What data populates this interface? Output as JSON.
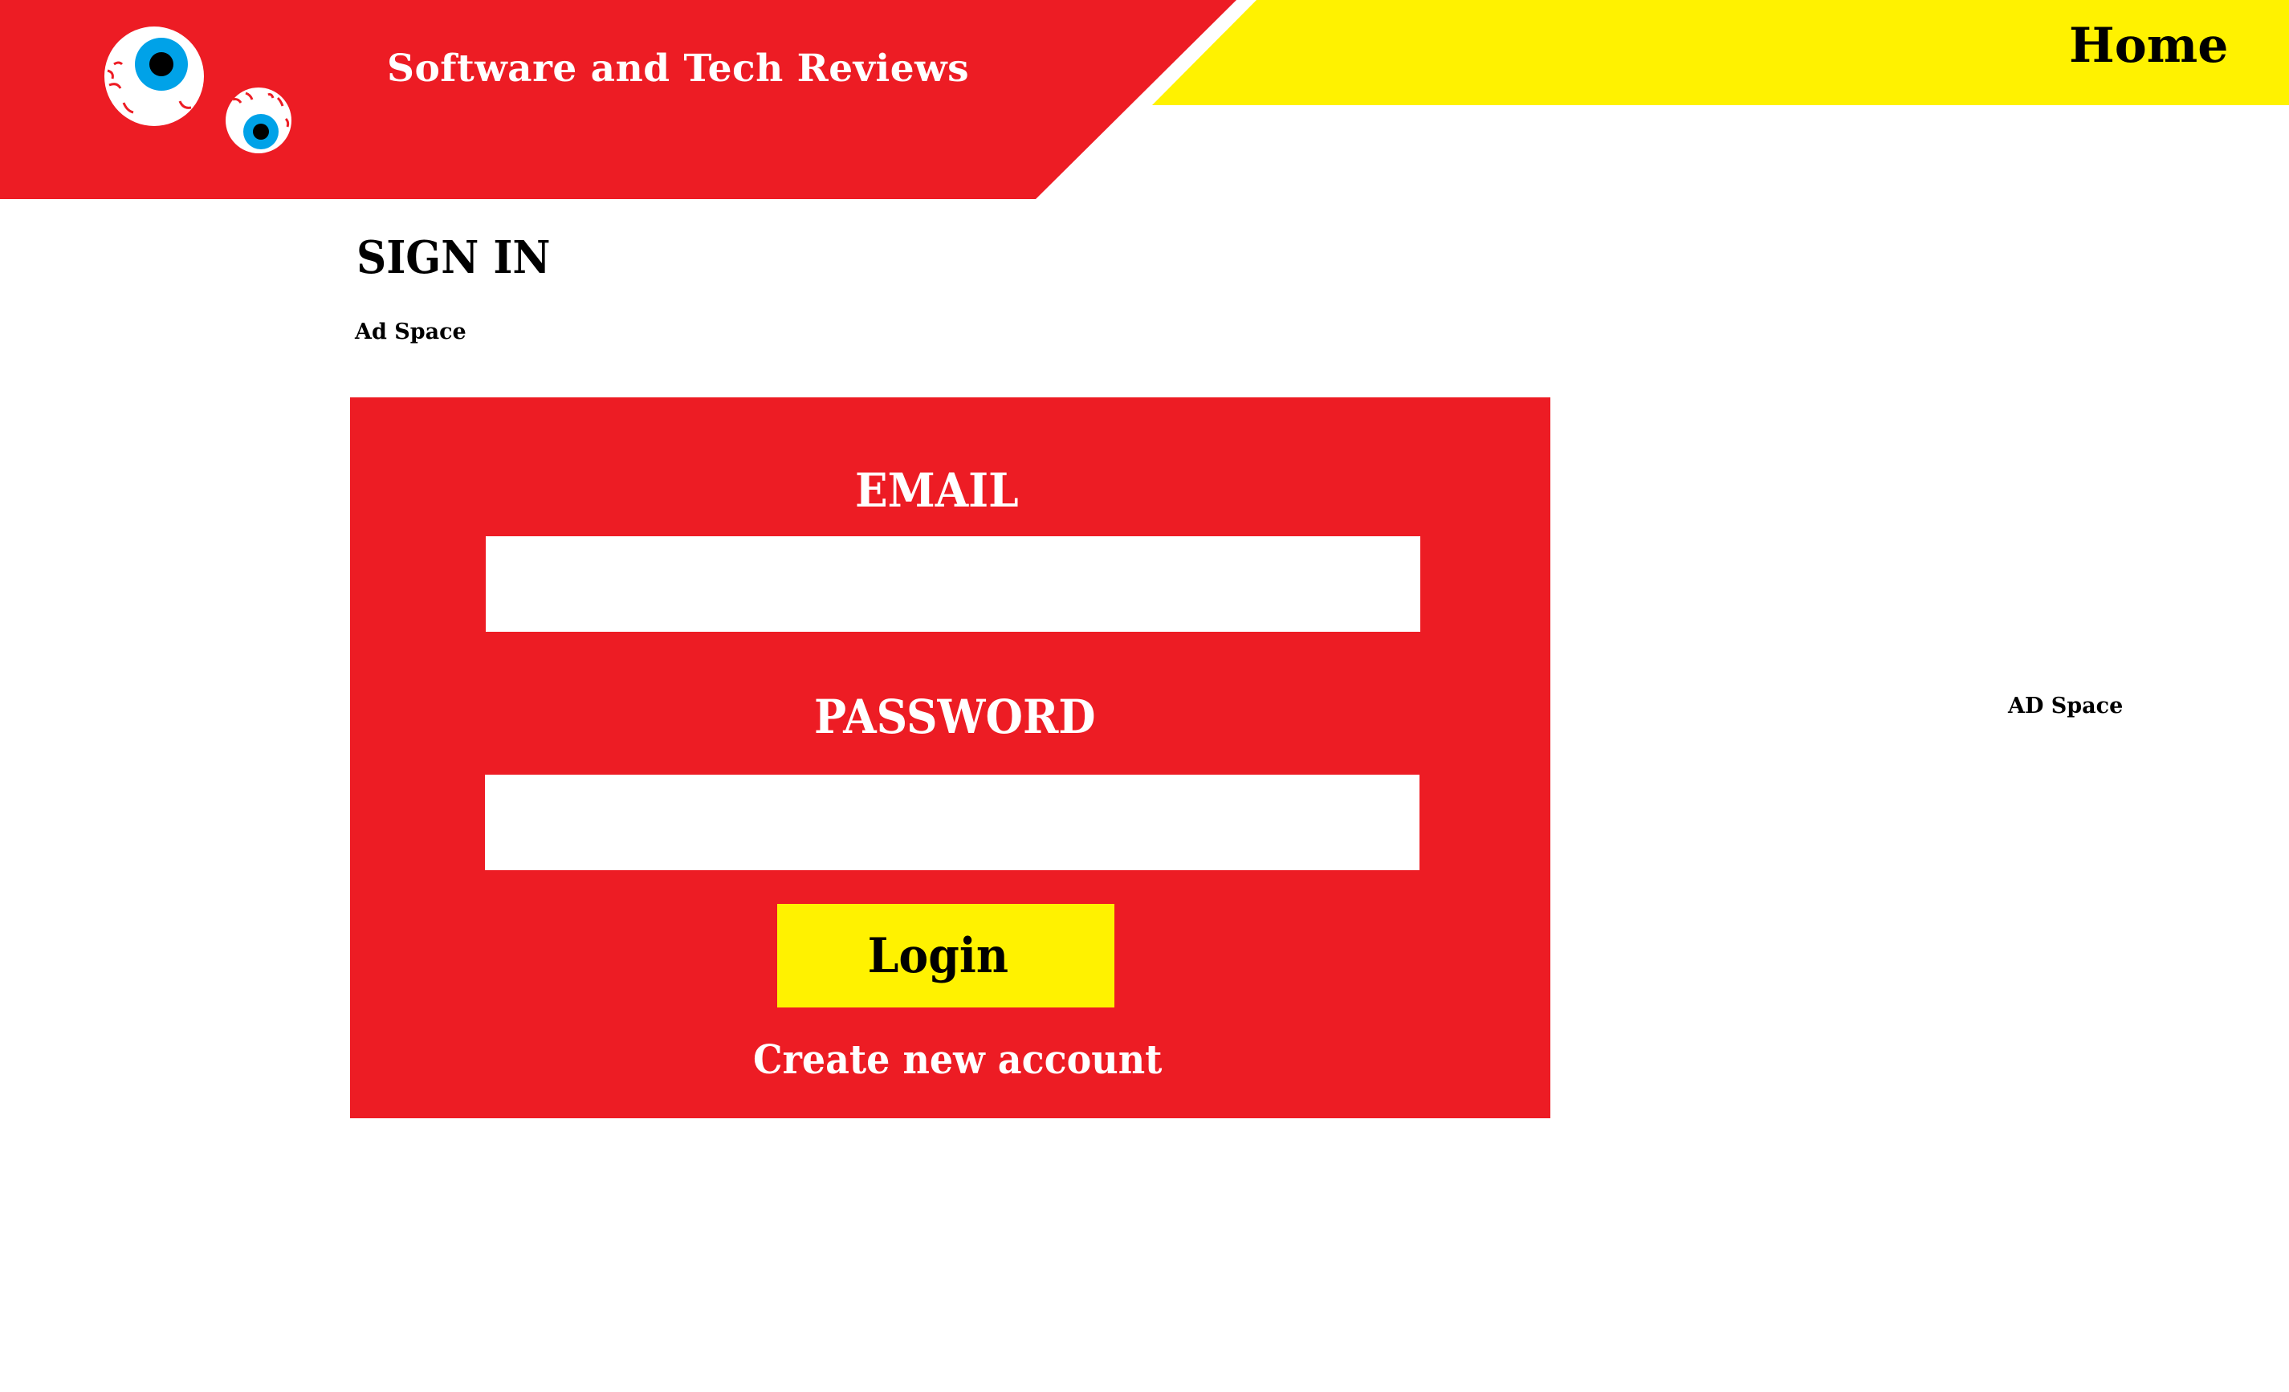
{
  "header": {
    "site_title": "Software and Tech Reviews",
    "logo_icon": "eyeballs-logo-icon",
    "nav_home": "Home"
  },
  "main": {
    "page_title": "SIGN IN",
    "ad_left": "Ad Space",
    "ad_right": "AD Space"
  },
  "login_form": {
    "email_label": "EMAIL",
    "email_value": "",
    "password_label": "PASSWORD",
    "password_value": "",
    "login_button": "Login",
    "create_account_link": "Create new account"
  },
  "colors": {
    "primary_red": "#ed1c24",
    "accent_yellow": "#fff200",
    "eye_iris": "#00a2e8",
    "background": "#ffffff"
  }
}
